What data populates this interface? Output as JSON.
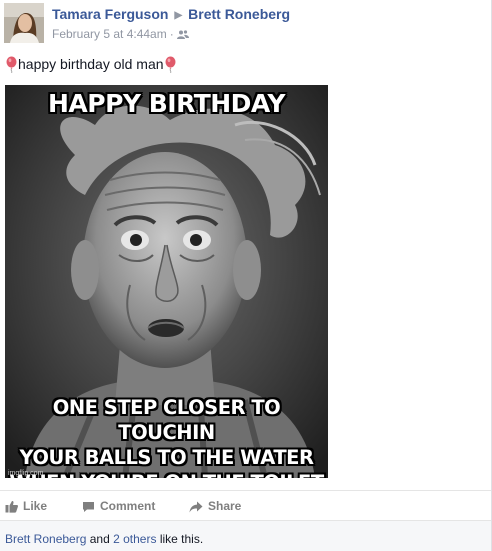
{
  "post": {
    "author": "Tamara Ferguson",
    "target": "Brett Roneberg",
    "timestamp": "February 5 at 4:44am",
    "audience_icon": "friends-icon",
    "status_text": "happy birthday old man",
    "emoji": "balloon-icon"
  },
  "photo": {
    "top_caption": "HAPPY BIRTHDAY",
    "bottom_caption_line1": "ONE STEP CLOSER TO TOUCHIN",
    "bottom_caption_line2": "YOUR BALLS TO THE WATER",
    "bottom_caption_line3": "WHEN YOU'RE ON THE TOILET",
    "watermark": "imgflip.com"
  },
  "actions": {
    "like": "Like",
    "comment": "Comment",
    "share": "Share"
  },
  "likes": {
    "name": "Brett Roneberg",
    "and": "and",
    "others": "2 others",
    "suffix": "like this."
  },
  "colors": {
    "link": "#3b5998",
    "meta": "#9197a3",
    "action": "#7f7f7f",
    "likes_bg": "#f6f7f9"
  }
}
